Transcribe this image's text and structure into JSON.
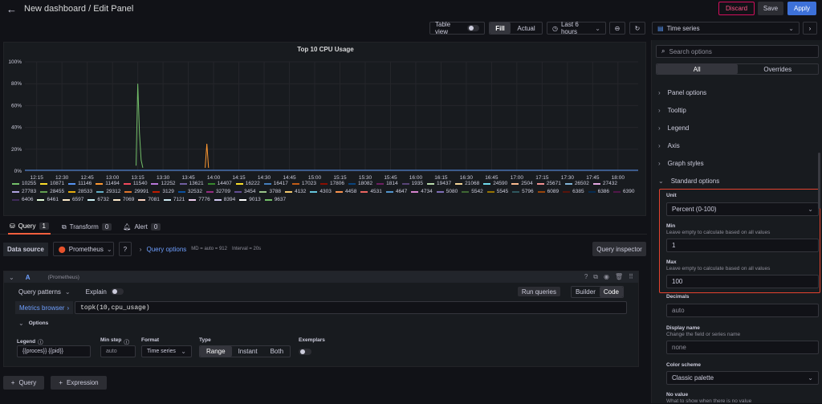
{
  "header": {
    "title": "New dashboard / Edit Panel",
    "discard": "Discard",
    "save": "Save",
    "apply": "Apply"
  },
  "toolbar": {
    "table_view": "Table view",
    "fill": "Fill",
    "actual": "Actual",
    "time_range": "Last 6 hours"
  },
  "viz": {
    "selected": "Time series"
  },
  "options": {
    "search_placeholder": "Search options",
    "tab_all": "All",
    "tab_overrides": "Overrides",
    "sections": [
      "Panel options",
      "Tooltip",
      "Legend",
      "Axis",
      "Graph styles",
      "Standard options"
    ],
    "unit_label": "Unit",
    "unit_value": "Percent (0-100)",
    "min_label": "Min",
    "min_desc": "Leave empty to calculate based on all values",
    "min_value": "1",
    "max_label": "Max",
    "max_desc": "Leave empty to calculate based on all values",
    "max_value": "100",
    "decimals_label": "Decimals",
    "decimals_placeholder": "auto",
    "display_name_label": "Display name",
    "display_name_desc": "Change the field or series name",
    "display_name_placeholder": "none",
    "color_scheme_label": "Color scheme",
    "color_scheme_value": "Classic palette",
    "no_value_label": "No value",
    "no_value_desc": "What to show when there is no value"
  },
  "chart_data": {
    "type": "line",
    "title": "Top 10 CPU Usage",
    "ylim": [
      0,
      100
    ],
    "y_ticks": [
      "0%",
      "20%",
      "40%",
      "60%",
      "80%",
      "100%"
    ],
    "x_ticks": [
      "12:15",
      "12:30",
      "12:45",
      "13:00",
      "13:15",
      "13:30",
      "13:45",
      "14:00",
      "14:15",
      "14:30",
      "14:45",
      "15:00",
      "15:15",
      "15:30",
      "15:45",
      "16:00",
      "16:15",
      "16:30",
      "16:45",
      "17:00",
      "17:15",
      "17:30",
      "17:45",
      "18:00"
    ],
    "grid": true,
    "legend_placement": "bottom",
    "legend": [
      {
        "name": "10255",
        "color": "#73bf69"
      },
      {
        "name": "10871",
        "color": "#fade2a"
      },
      {
        "name": "11146",
        "color": "#5794f2"
      },
      {
        "name": "11494",
        "color": "#ff9830"
      },
      {
        "name": "11540",
        "color": "#f2495c"
      },
      {
        "name": "12252",
        "color": "#b877d9"
      },
      {
        "name": "13621",
        "color": "#705da0"
      },
      {
        "name": "14407",
        "color": "#37872d"
      },
      {
        "name": "16222",
        "color": "#fade2a"
      },
      {
        "name": "16417",
        "color": "#447ebc"
      },
      {
        "name": "17023",
        "color": "#c15c17"
      },
      {
        "name": "17806",
        "color": "#890f02"
      },
      {
        "name": "18082",
        "color": "#0a437c"
      },
      {
        "name": "1814",
        "color": "#6d1f62"
      },
      {
        "name": "1935",
        "color": "#584477"
      },
      {
        "name": "19437",
        "color": "#b7dbab"
      },
      {
        "name": "21068",
        "color": "#f4d598"
      },
      {
        "name": "24590",
        "color": "#70dbed"
      },
      {
        "name": "2504",
        "color": "#f9ba8f"
      },
      {
        "name": "25671",
        "color": "#f29191"
      },
      {
        "name": "26502",
        "color": "#82b5d8"
      },
      {
        "name": "27432",
        "color": "#e5a8e2"
      },
      {
        "name": "27783",
        "color": "#aea2e0"
      },
      {
        "name": "28455",
        "color": "#629e51"
      },
      {
        "name": "28533",
        "color": "#e5ac0e"
      },
      {
        "name": "29312",
        "color": "#64b0c8"
      },
      {
        "name": "29991",
        "color": "#e0752d"
      },
      {
        "name": "3129",
        "color": "#bf1b00"
      },
      {
        "name": "32532",
        "color": "#0a50a1"
      },
      {
        "name": "32709",
        "color": "#962d82"
      },
      {
        "name": "3454",
        "color": "#614d93"
      },
      {
        "name": "3788",
        "color": "#9ac48a"
      },
      {
        "name": "4132",
        "color": "#f2c96d"
      },
      {
        "name": "4303",
        "color": "#65c5db"
      },
      {
        "name": "4458",
        "color": "#f9934e"
      },
      {
        "name": "4531",
        "color": "#ea6460"
      },
      {
        "name": "4647",
        "color": "#5195ce"
      },
      {
        "name": "4734",
        "color": "#d683ce"
      },
      {
        "name": "5080",
        "color": "#806eb7"
      },
      {
        "name": "5542",
        "color": "#3f6833"
      },
      {
        "name": "5545",
        "color": "#967302"
      },
      {
        "name": "5796",
        "color": "#2f575e"
      },
      {
        "name": "6089",
        "color": "#99440a"
      },
      {
        "name": "6385",
        "color": "#58140c"
      },
      {
        "name": "6386",
        "color": "#052b51"
      },
      {
        "name": "6390",
        "color": "#511749"
      },
      {
        "name": "6406",
        "color": "#3f2b5b"
      },
      {
        "name": "6461",
        "color": "#e0f9d7"
      },
      {
        "name": "6597",
        "color": "#fcEACA"
      },
      {
        "name": "6732",
        "color": "#cff1f5"
      },
      {
        "name": "7069",
        "color": "#fceacb"
      },
      {
        "name": "7081",
        "color": "#fad3c0"
      },
      {
        "name": "7121",
        "color": "#cce8f0"
      },
      {
        "name": "7776",
        "color": "#f0d0f0"
      },
      {
        "name": "8394",
        "color": "#d0c8f0"
      },
      {
        "name": "9013",
        "color": "#ffffff"
      },
      {
        "name": "9637",
        "color": "#73bf69"
      }
    ],
    "series": [
      {
        "name": "10255",
        "x": [
          "13:14",
          "13:15",
          "13:16",
          "13:17",
          "13:18"
        ],
        "values": [
          5,
          80,
          35,
          10,
          3
        ]
      },
      {
        "name": "11494",
        "x": [
          "13:55",
          "13:56",
          "13:57"
        ],
        "values": [
          3,
          25,
          3
        ]
      }
    ]
  },
  "query": {
    "tabs": [
      {
        "label": "Query",
        "count": "1"
      },
      {
        "label": "Transform",
        "count": "0"
      },
      {
        "label": "Alert",
        "count": "0"
      }
    ],
    "datasource_label": "Data source",
    "datasource": "Prometheus",
    "query_options": "Query options",
    "query_meta1": "MD = auto = 912",
    "query_meta2": "Interval = 20s",
    "inspector": "Query inspector",
    "ref_id": "A",
    "ref_source": "(Prometheus)",
    "patterns": "Query patterns",
    "explain": "Explain",
    "run": "Run queries",
    "builder": "Builder",
    "code": "Code",
    "metrics_browser": "Metrics browser",
    "expr": "topk(10,cpu_usage)",
    "options_label": "Options",
    "legend_label": "Legend",
    "legend_value": "{{proces}} {{pid}}",
    "minstep_label": "Min step",
    "minstep_placeholder": "auto",
    "format_label": "Format",
    "format_value": "Time series",
    "type_label": "Type",
    "type_range": "Range",
    "type_instant": "Instant",
    "type_both": "Both",
    "exemplars_label": "Exemplars",
    "add_query": "Query",
    "add_expression": "Expression"
  }
}
